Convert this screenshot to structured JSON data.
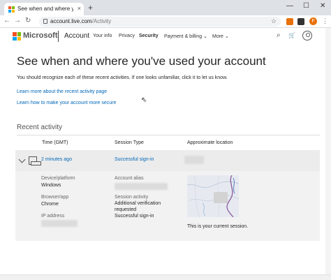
{
  "browser": {
    "tab_title": "See when and where you've used",
    "close_glyph": "×",
    "newtab_glyph": "+",
    "url_host": "account.live.com",
    "url_path": "/Activity",
    "star_glyph": "☆",
    "profile_initial": "F",
    "minimize_glyph": "—",
    "maximize_glyph": "☐",
    "winclose_glyph": "✕",
    "back_glyph": "←",
    "forward_glyph": "→",
    "reload_glyph": "↻",
    "menu_glyph": "⋮"
  },
  "header": {
    "brand": "Microsoft",
    "section": "Account",
    "nav": [
      {
        "label": "Your info"
      },
      {
        "label": "Privacy"
      },
      {
        "label": "Security"
      },
      {
        "label": "Payment & billing ⌄"
      },
      {
        "label": "More ⌄"
      }
    ],
    "search_glyph": "⌕",
    "cart_glyph": "🛒"
  },
  "main": {
    "title": "See when and where you've used your account",
    "intro": "You should recognize each of these recent activities. If one looks unfamiliar, click it to let us know.",
    "links": [
      "Learn more about the recent activity page",
      "Learn how to make your account more secure"
    ]
  },
  "activity": {
    "section_title": "Recent activity",
    "columns": [
      "Time (GMT)",
      "Session Type",
      "Approximate location"
    ],
    "row": {
      "time": "2 minutes ago",
      "type": "Successful sign-in"
    },
    "detail": {
      "device_label": "Device/platform",
      "device_value": "Windows",
      "browser_label": "Browser/app",
      "browser_value": "Chrome",
      "ip_label": "IP address",
      "alias_label": "Account alias",
      "session_label": "Session activity",
      "session_values": [
        "Additional verification",
        "requested",
        "Successful sign-in"
      ],
      "current_session": "This is your current session."
    }
  },
  "colors": {
    "link": "#0067b8",
    "ms_red": "#f25022",
    "ms_green": "#7fba00",
    "ms_blue": "#00a4ef",
    "ms_yellow": "#ffb900"
  }
}
